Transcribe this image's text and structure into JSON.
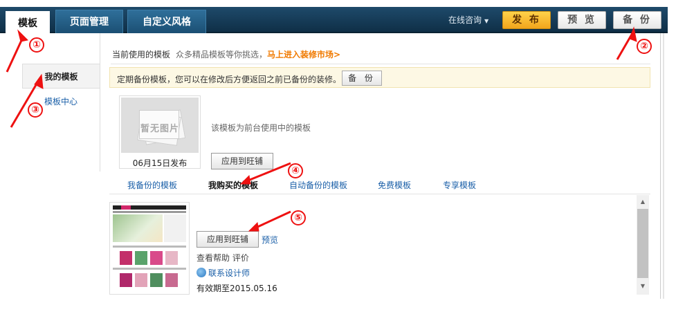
{
  "topnav": {
    "tabs": [
      "模板",
      "页面管理",
      "自定义风格"
    ],
    "consult": "在线咨询",
    "publish": "发 布",
    "preview": "预 览",
    "backup": "备 份"
  },
  "sidebar": {
    "my_templates": "我的模板",
    "template_center": "模板中心"
  },
  "header": {
    "current": "当前使用的模板",
    "muted": "众多精品模板等你挑选，",
    "market_link": "马上进入装修市场>"
  },
  "notice": {
    "text": "定期备份模板，您可以在修改后方便返回之前已备份的装修。",
    "button": "备 份"
  },
  "current_template": {
    "no_image": "暂无图片",
    "caption": "06月15日发布",
    "desc": "该模板为前台使用中的模板",
    "apply": "应用到旺铺"
  },
  "subtabs": [
    "我备份的模板",
    "我购买的模板",
    "自动备份的模板",
    "免费模板",
    "专享模板"
  ],
  "item": {
    "apply": "应用到旺铺",
    "preview": "预览",
    "help": "查看帮助 评价",
    "contact": "联系设计师",
    "valid": "有效期至2015.05.16"
  },
  "annotations": [
    "①",
    "②",
    "③",
    "④",
    "⑤"
  ],
  "colors": {
    "nav_bg": "#1e4a6a",
    "publish_bg": "#f2a51c",
    "link": "#1a5fa8",
    "market_link": "#f07a00",
    "annotation": "#e11111"
  }
}
